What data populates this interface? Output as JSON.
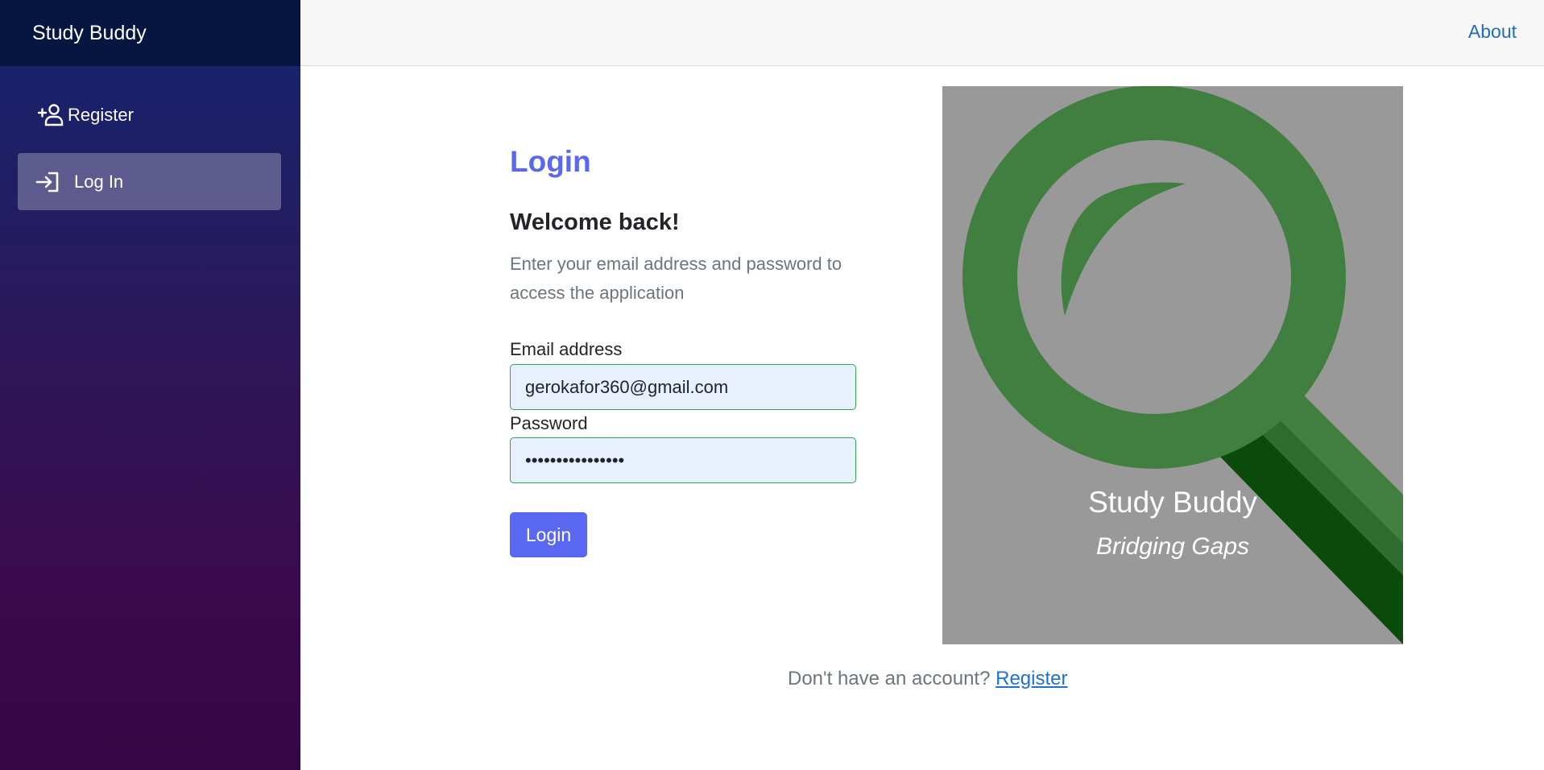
{
  "app": {
    "brand": "Study Buddy"
  },
  "sidebar": {
    "items": [
      {
        "label": "Register",
        "icon": "add-user-icon",
        "active": false
      },
      {
        "label": "Log In",
        "icon": "login-icon",
        "active": true
      }
    ]
  },
  "topbar": {
    "about_label": "About"
  },
  "login": {
    "title": "Login",
    "welcome": "Welcome back!",
    "description": "Enter your email address and password to access the application",
    "email_label": "Email address",
    "email_value": "gerokafor360@gmail.com",
    "password_label": "Password",
    "password_value": "••••••••••••••••",
    "submit_label": "Login"
  },
  "logo": {
    "name": "Study Buddy",
    "tagline": "Bridging Gaps",
    "colors": {
      "background": "#999999",
      "ring": "#417f41",
      "handle_dark": "#0a4a0a",
      "handle_mid": "#2e6b2e"
    }
  },
  "footer": {
    "prompt": "Don't have an account?",
    "link_label": "Register"
  },
  "colors": {
    "accent": "#5a67f0",
    "link": "#1f6fb8",
    "valid_border": "#2fa84f"
  }
}
